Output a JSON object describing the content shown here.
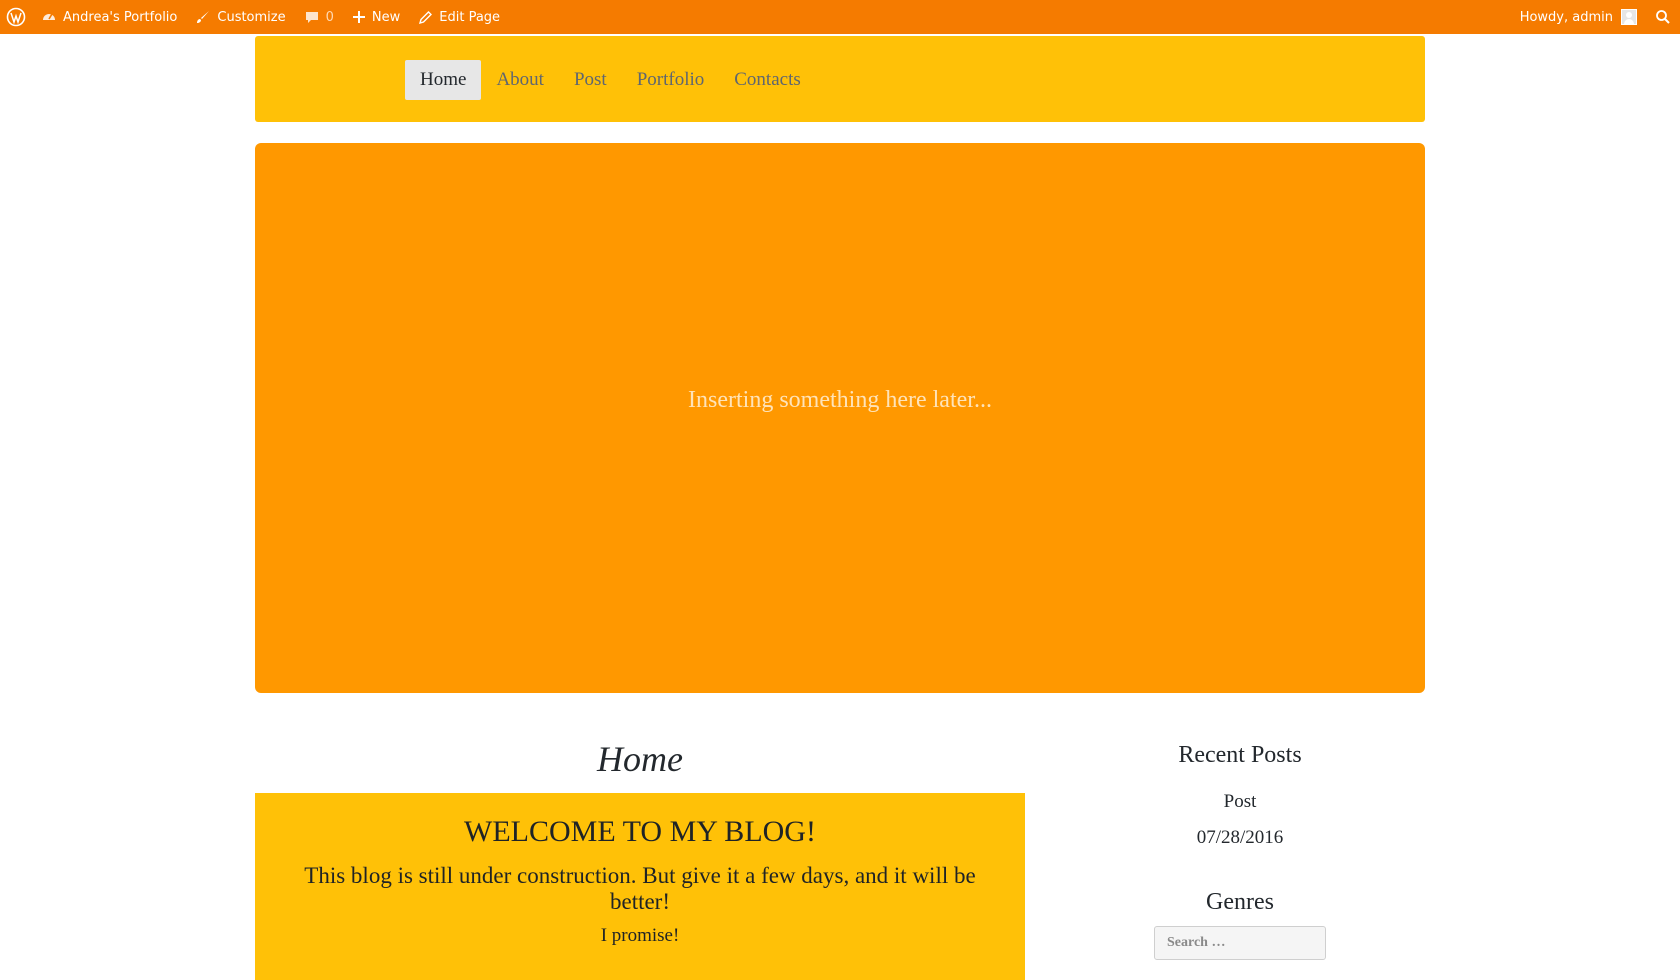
{
  "adminbar": {
    "site_name": "Andrea's Portfolio",
    "customize": "Customize",
    "comments_count": "0",
    "new": "New",
    "edit_page": "Edit Page",
    "greeting": "Howdy, admin",
    "icons": [
      "wordpress-logo-icon",
      "dashboard-icon",
      "paintbrush-icon",
      "comment-icon",
      "plus-icon",
      "pencil-icon",
      "avatar-icon",
      "search-icon"
    ]
  },
  "nav": {
    "items": [
      {
        "label": "Home",
        "active": true
      },
      {
        "label": "About",
        "active": false
      },
      {
        "label": "Post",
        "active": false
      },
      {
        "label": "Portfolio",
        "active": false
      },
      {
        "label": "Contacts",
        "active": false
      }
    ]
  },
  "hero": {
    "text": "Inserting something here later..."
  },
  "main": {
    "page_title": "Home",
    "welcome_heading": "WELCOME TO MY BLOG!",
    "welcome_text": "This blog is still under construction. But give it a few days, and it will be better!",
    "promise": "I promise!"
  },
  "sidebar": {
    "recent_title": "Recent Posts",
    "recent_post": "Post",
    "recent_date": "07/28/2016",
    "genres_title": "Genres",
    "search_placeholder": "Search …"
  },
  "colors": {
    "adminbar": "#f57b00",
    "nav_bg": "#ffc107",
    "hero_bg": "#ff9800",
    "welcome_bg": "#ffc107"
  }
}
